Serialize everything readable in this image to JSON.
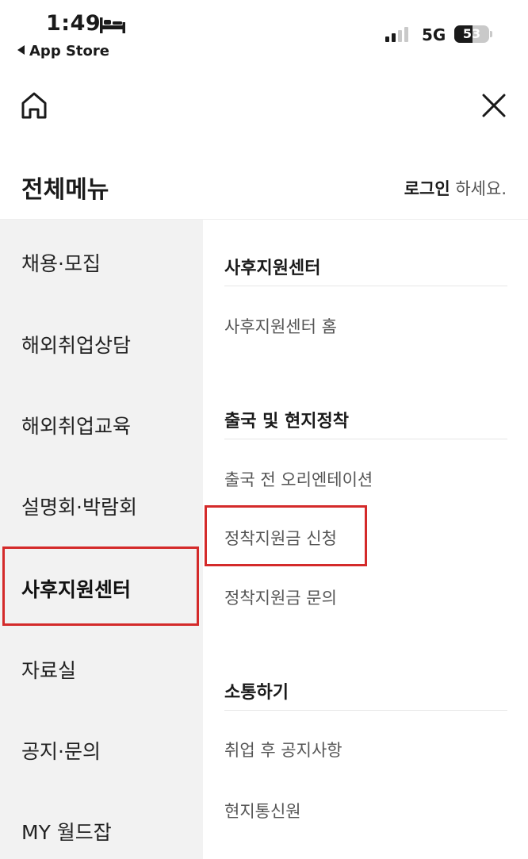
{
  "status_bar": {
    "time": "1:49",
    "back_label": "App Store",
    "network": "5G",
    "battery": "53",
    "battery_level": 0.53
  },
  "header": {
    "title": "전체메뉴",
    "login_link": "로그인",
    "login_suffix": " 하세요."
  },
  "left_menu": {
    "items": [
      {
        "label": "채용·모집"
      },
      {
        "label": "해외취업상담"
      },
      {
        "label": "해외취업교육"
      },
      {
        "label": "설명회·박람회"
      },
      {
        "label": "사후지원센터",
        "active": true
      },
      {
        "label": "자료실"
      },
      {
        "label": "공지·문의"
      },
      {
        "label": "MY 월드잡"
      }
    ]
  },
  "right_menu": {
    "sections": [
      {
        "title": "사후지원센터",
        "items": [
          "사후지원센터 홈"
        ]
      },
      {
        "title": "출국 및 현지정착",
        "items": [
          "출국 전 오리엔테이션",
          "정착지원금 신청",
          "정착지원금 문의"
        ]
      },
      {
        "title": "소통하기",
        "items": [
          "취업 후 공지사항",
          "현지통신원"
        ]
      }
    ]
  },
  "icons": {
    "home": "home-icon",
    "close": "close-icon",
    "bed": "bed-icon",
    "signal": "signal-icon",
    "battery": "battery-icon"
  },
  "colors": {
    "highlight": "#d42a2a",
    "left_bg": "#f2f2f2"
  }
}
